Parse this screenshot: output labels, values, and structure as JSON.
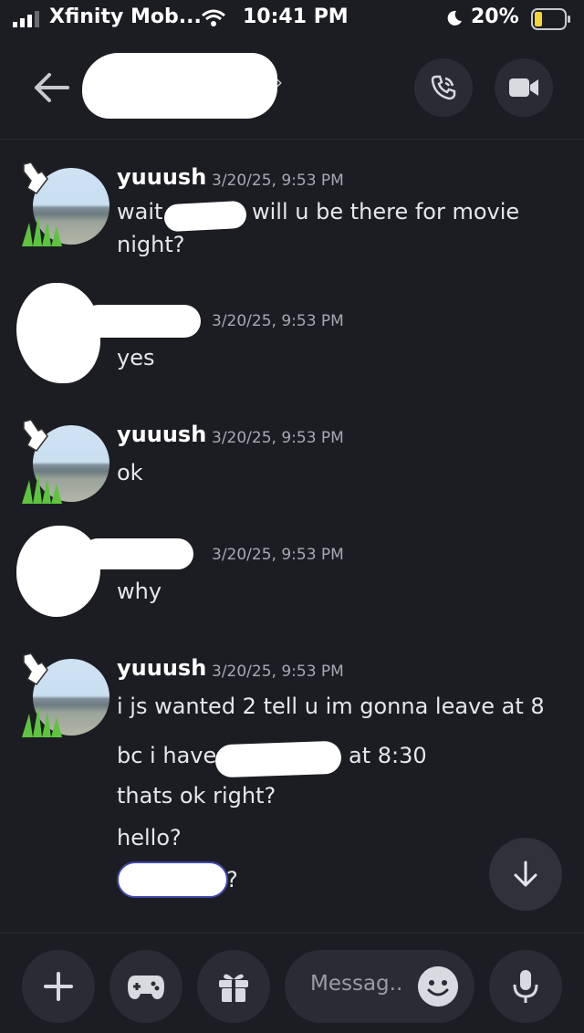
{
  "status_bar": {
    "carrier": "Xfinity Mob...",
    "time": "10:41 PM",
    "battery": "20%"
  },
  "header": {
    "chevron": "›",
    "icons": [
      "back-arrow-icon",
      "phone-call-icon",
      "video-camera-icon"
    ]
  },
  "messages": [
    {
      "username": "yuuush",
      "timestamp": "3/20/25, 9:53 PM",
      "lines": [
        "wait",
        "will u be there for movie",
        "night?"
      ]
    },
    {
      "username": "",
      "timestamp": "3/20/25, 9:53 PM",
      "lines": [
        "yes"
      ]
    },
    {
      "username": "yuuush",
      "timestamp": "3/20/25, 9:53 PM",
      "lines": [
        "ok"
      ]
    },
    {
      "username": "",
      "timestamp": "3/20/25, 9:53 PM",
      "lines": [
        "why"
      ]
    },
    {
      "username": "yuuush",
      "timestamp": "3/20/25, 9:53 PM",
      "lines": [
        "i js wanted 2 tell u im gonna leave at 8",
        "bc i have",
        "at 8:30",
        "thats ok right?",
        "hello?",
        "?"
      ]
    }
  ],
  "composer": {
    "placeholder": "Messag..",
    "icons": [
      "plus-icon",
      "gamepad-icon",
      "gift-icon",
      "emoji-icon",
      "microphone-icon"
    ]
  },
  "colors": {
    "background": "#1c1d22",
    "button": "#2b2c33",
    "text": "#e6e7ea",
    "muted": "#a7a9b1"
  }
}
